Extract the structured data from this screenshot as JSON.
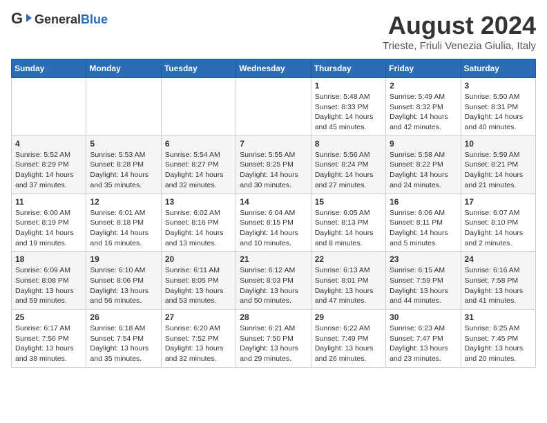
{
  "header": {
    "logo_general": "General",
    "logo_blue": "Blue",
    "title": "August 2024",
    "subtitle": "Trieste, Friuli Venezia Giulia, Italy"
  },
  "calendar": {
    "days_of_week": [
      "Sunday",
      "Monday",
      "Tuesday",
      "Wednesday",
      "Thursday",
      "Friday",
      "Saturday"
    ],
    "weeks": [
      [
        {
          "day": "",
          "info": ""
        },
        {
          "day": "",
          "info": ""
        },
        {
          "day": "",
          "info": ""
        },
        {
          "day": "",
          "info": ""
        },
        {
          "day": "1",
          "info": "Sunrise: 5:48 AM\nSunset: 8:33 PM\nDaylight: 14 hours\nand 45 minutes."
        },
        {
          "day": "2",
          "info": "Sunrise: 5:49 AM\nSunset: 8:32 PM\nDaylight: 14 hours\nand 42 minutes."
        },
        {
          "day": "3",
          "info": "Sunrise: 5:50 AM\nSunset: 8:31 PM\nDaylight: 14 hours\nand 40 minutes."
        }
      ],
      [
        {
          "day": "4",
          "info": "Sunrise: 5:52 AM\nSunset: 8:29 PM\nDaylight: 14 hours\nand 37 minutes."
        },
        {
          "day": "5",
          "info": "Sunrise: 5:53 AM\nSunset: 8:28 PM\nDaylight: 14 hours\nand 35 minutes."
        },
        {
          "day": "6",
          "info": "Sunrise: 5:54 AM\nSunset: 8:27 PM\nDaylight: 14 hours\nand 32 minutes."
        },
        {
          "day": "7",
          "info": "Sunrise: 5:55 AM\nSunset: 8:25 PM\nDaylight: 14 hours\nand 30 minutes."
        },
        {
          "day": "8",
          "info": "Sunrise: 5:56 AM\nSunset: 8:24 PM\nDaylight: 14 hours\nand 27 minutes."
        },
        {
          "day": "9",
          "info": "Sunrise: 5:58 AM\nSunset: 8:22 PM\nDaylight: 14 hours\nand 24 minutes."
        },
        {
          "day": "10",
          "info": "Sunrise: 5:59 AM\nSunset: 8:21 PM\nDaylight: 14 hours\nand 21 minutes."
        }
      ],
      [
        {
          "day": "11",
          "info": "Sunrise: 6:00 AM\nSunset: 8:19 PM\nDaylight: 14 hours\nand 19 minutes."
        },
        {
          "day": "12",
          "info": "Sunrise: 6:01 AM\nSunset: 8:18 PM\nDaylight: 14 hours\nand 16 minutes."
        },
        {
          "day": "13",
          "info": "Sunrise: 6:02 AM\nSunset: 8:16 PM\nDaylight: 14 hours\nand 13 minutes."
        },
        {
          "day": "14",
          "info": "Sunrise: 6:04 AM\nSunset: 8:15 PM\nDaylight: 14 hours\nand 10 minutes."
        },
        {
          "day": "15",
          "info": "Sunrise: 6:05 AM\nSunset: 8:13 PM\nDaylight: 14 hours\nand 8 minutes."
        },
        {
          "day": "16",
          "info": "Sunrise: 6:06 AM\nSunset: 8:11 PM\nDaylight: 14 hours\nand 5 minutes."
        },
        {
          "day": "17",
          "info": "Sunrise: 6:07 AM\nSunset: 8:10 PM\nDaylight: 14 hours\nand 2 minutes."
        }
      ],
      [
        {
          "day": "18",
          "info": "Sunrise: 6:09 AM\nSunset: 8:08 PM\nDaylight: 13 hours\nand 59 minutes."
        },
        {
          "day": "19",
          "info": "Sunrise: 6:10 AM\nSunset: 8:06 PM\nDaylight: 13 hours\nand 56 minutes."
        },
        {
          "day": "20",
          "info": "Sunrise: 6:11 AM\nSunset: 8:05 PM\nDaylight: 13 hours\nand 53 minutes."
        },
        {
          "day": "21",
          "info": "Sunrise: 6:12 AM\nSunset: 8:03 PM\nDaylight: 13 hours\nand 50 minutes."
        },
        {
          "day": "22",
          "info": "Sunrise: 6:13 AM\nSunset: 8:01 PM\nDaylight: 13 hours\nand 47 minutes."
        },
        {
          "day": "23",
          "info": "Sunrise: 6:15 AM\nSunset: 7:59 PM\nDaylight: 13 hours\nand 44 minutes."
        },
        {
          "day": "24",
          "info": "Sunrise: 6:16 AM\nSunset: 7:58 PM\nDaylight: 13 hours\nand 41 minutes."
        }
      ],
      [
        {
          "day": "25",
          "info": "Sunrise: 6:17 AM\nSunset: 7:56 PM\nDaylight: 13 hours\nand 38 minutes."
        },
        {
          "day": "26",
          "info": "Sunrise: 6:18 AM\nSunset: 7:54 PM\nDaylight: 13 hours\nand 35 minutes."
        },
        {
          "day": "27",
          "info": "Sunrise: 6:20 AM\nSunset: 7:52 PM\nDaylight: 13 hours\nand 32 minutes."
        },
        {
          "day": "28",
          "info": "Sunrise: 6:21 AM\nSunset: 7:50 PM\nDaylight: 13 hours\nand 29 minutes."
        },
        {
          "day": "29",
          "info": "Sunrise: 6:22 AM\nSunset: 7:49 PM\nDaylight: 13 hours\nand 26 minutes."
        },
        {
          "day": "30",
          "info": "Sunrise: 6:23 AM\nSunset: 7:47 PM\nDaylight: 13 hours\nand 23 minutes."
        },
        {
          "day": "31",
          "info": "Sunrise: 6:25 AM\nSunset: 7:45 PM\nDaylight: 13 hours\nand 20 minutes."
        }
      ]
    ]
  }
}
